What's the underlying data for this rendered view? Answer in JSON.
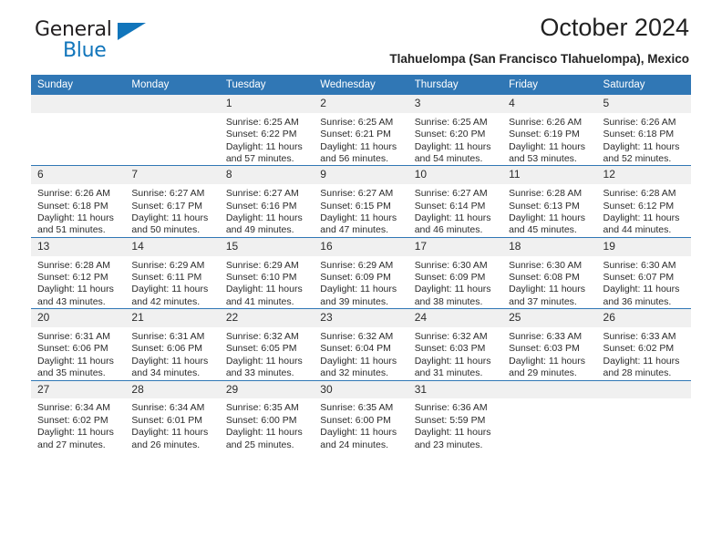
{
  "brand": {
    "name_part1": "General",
    "name_part2": "Blue",
    "accent_color": "#1175bb"
  },
  "header": {
    "title": "October 2024",
    "subtitle": "Tlahuelompa (San Francisco Tlahuelompa), Mexico",
    "header_bg": "#3077b5"
  },
  "weekdays": [
    "Sunday",
    "Monday",
    "Tuesday",
    "Wednesday",
    "Thursday",
    "Friday",
    "Saturday"
  ],
  "labels": {
    "sunrise_prefix": "Sunrise: ",
    "sunset_prefix": "Sunset: ",
    "daylight_prefix": "Daylight: "
  },
  "weeks": [
    [
      {
        "day": "",
        "sunrise": "",
        "sunset": "",
        "daylight_line1": "",
        "daylight_line2": ""
      },
      {
        "day": "",
        "sunrise": "",
        "sunset": "",
        "daylight_line1": "",
        "daylight_line2": ""
      },
      {
        "day": "1",
        "sunrise": "Sunrise: 6:25 AM",
        "sunset": "Sunset: 6:22 PM",
        "daylight_line1": "Daylight: 11 hours",
        "daylight_line2": "and 57 minutes."
      },
      {
        "day": "2",
        "sunrise": "Sunrise: 6:25 AM",
        "sunset": "Sunset: 6:21 PM",
        "daylight_line1": "Daylight: 11 hours",
        "daylight_line2": "and 56 minutes."
      },
      {
        "day": "3",
        "sunrise": "Sunrise: 6:25 AM",
        "sunset": "Sunset: 6:20 PM",
        "daylight_line1": "Daylight: 11 hours",
        "daylight_line2": "and 54 minutes."
      },
      {
        "day": "4",
        "sunrise": "Sunrise: 6:26 AM",
        "sunset": "Sunset: 6:19 PM",
        "daylight_line1": "Daylight: 11 hours",
        "daylight_line2": "and 53 minutes."
      },
      {
        "day": "5",
        "sunrise": "Sunrise: 6:26 AM",
        "sunset": "Sunset: 6:18 PM",
        "daylight_line1": "Daylight: 11 hours",
        "daylight_line2": "and 52 minutes."
      }
    ],
    [
      {
        "day": "6",
        "sunrise": "Sunrise: 6:26 AM",
        "sunset": "Sunset: 6:18 PM",
        "daylight_line1": "Daylight: 11 hours",
        "daylight_line2": "and 51 minutes."
      },
      {
        "day": "7",
        "sunrise": "Sunrise: 6:27 AM",
        "sunset": "Sunset: 6:17 PM",
        "daylight_line1": "Daylight: 11 hours",
        "daylight_line2": "and 50 minutes."
      },
      {
        "day": "8",
        "sunrise": "Sunrise: 6:27 AM",
        "sunset": "Sunset: 6:16 PM",
        "daylight_line1": "Daylight: 11 hours",
        "daylight_line2": "and 49 minutes."
      },
      {
        "day": "9",
        "sunrise": "Sunrise: 6:27 AM",
        "sunset": "Sunset: 6:15 PM",
        "daylight_line1": "Daylight: 11 hours",
        "daylight_line2": "and 47 minutes."
      },
      {
        "day": "10",
        "sunrise": "Sunrise: 6:27 AM",
        "sunset": "Sunset: 6:14 PM",
        "daylight_line1": "Daylight: 11 hours",
        "daylight_line2": "and 46 minutes."
      },
      {
        "day": "11",
        "sunrise": "Sunrise: 6:28 AM",
        "sunset": "Sunset: 6:13 PM",
        "daylight_line1": "Daylight: 11 hours",
        "daylight_line2": "and 45 minutes."
      },
      {
        "day": "12",
        "sunrise": "Sunrise: 6:28 AM",
        "sunset": "Sunset: 6:12 PM",
        "daylight_line1": "Daylight: 11 hours",
        "daylight_line2": "and 44 minutes."
      }
    ],
    [
      {
        "day": "13",
        "sunrise": "Sunrise: 6:28 AM",
        "sunset": "Sunset: 6:12 PM",
        "daylight_line1": "Daylight: 11 hours",
        "daylight_line2": "and 43 minutes."
      },
      {
        "day": "14",
        "sunrise": "Sunrise: 6:29 AM",
        "sunset": "Sunset: 6:11 PM",
        "daylight_line1": "Daylight: 11 hours",
        "daylight_line2": "and 42 minutes."
      },
      {
        "day": "15",
        "sunrise": "Sunrise: 6:29 AM",
        "sunset": "Sunset: 6:10 PM",
        "daylight_line1": "Daylight: 11 hours",
        "daylight_line2": "and 41 minutes."
      },
      {
        "day": "16",
        "sunrise": "Sunrise: 6:29 AM",
        "sunset": "Sunset: 6:09 PM",
        "daylight_line1": "Daylight: 11 hours",
        "daylight_line2": "and 39 minutes."
      },
      {
        "day": "17",
        "sunrise": "Sunrise: 6:30 AM",
        "sunset": "Sunset: 6:09 PM",
        "daylight_line1": "Daylight: 11 hours",
        "daylight_line2": "and 38 minutes."
      },
      {
        "day": "18",
        "sunrise": "Sunrise: 6:30 AM",
        "sunset": "Sunset: 6:08 PM",
        "daylight_line1": "Daylight: 11 hours",
        "daylight_line2": "and 37 minutes."
      },
      {
        "day": "19",
        "sunrise": "Sunrise: 6:30 AM",
        "sunset": "Sunset: 6:07 PM",
        "daylight_line1": "Daylight: 11 hours",
        "daylight_line2": "and 36 minutes."
      }
    ],
    [
      {
        "day": "20",
        "sunrise": "Sunrise: 6:31 AM",
        "sunset": "Sunset: 6:06 PM",
        "daylight_line1": "Daylight: 11 hours",
        "daylight_line2": "and 35 minutes."
      },
      {
        "day": "21",
        "sunrise": "Sunrise: 6:31 AM",
        "sunset": "Sunset: 6:06 PM",
        "daylight_line1": "Daylight: 11 hours",
        "daylight_line2": "and 34 minutes."
      },
      {
        "day": "22",
        "sunrise": "Sunrise: 6:32 AM",
        "sunset": "Sunset: 6:05 PM",
        "daylight_line1": "Daylight: 11 hours",
        "daylight_line2": "and 33 minutes."
      },
      {
        "day": "23",
        "sunrise": "Sunrise: 6:32 AM",
        "sunset": "Sunset: 6:04 PM",
        "daylight_line1": "Daylight: 11 hours",
        "daylight_line2": "and 32 minutes."
      },
      {
        "day": "24",
        "sunrise": "Sunrise: 6:32 AM",
        "sunset": "Sunset: 6:03 PM",
        "daylight_line1": "Daylight: 11 hours",
        "daylight_line2": "and 31 minutes."
      },
      {
        "day": "25",
        "sunrise": "Sunrise: 6:33 AM",
        "sunset": "Sunset: 6:03 PM",
        "daylight_line1": "Daylight: 11 hours",
        "daylight_line2": "and 29 minutes."
      },
      {
        "day": "26",
        "sunrise": "Sunrise: 6:33 AM",
        "sunset": "Sunset: 6:02 PM",
        "daylight_line1": "Daylight: 11 hours",
        "daylight_line2": "and 28 minutes."
      }
    ],
    [
      {
        "day": "27",
        "sunrise": "Sunrise: 6:34 AM",
        "sunset": "Sunset: 6:02 PM",
        "daylight_line1": "Daylight: 11 hours",
        "daylight_line2": "and 27 minutes."
      },
      {
        "day": "28",
        "sunrise": "Sunrise: 6:34 AM",
        "sunset": "Sunset: 6:01 PM",
        "daylight_line1": "Daylight: 11 hours",
        "daylight_line2": "and 26 minutes."
      },
      {
        "day": "29",
        "sunrise": "Sunrise: 6:35 AM",
        "sunset": "Sunset: 6:00 PM",
        "daylight_line1": "Daylight: 11 hours",
        "daylight_line2": "and 25 minutes."
      },
      {
        "day": "30",
        "sunrise": "Sunrise: 6:35 AM",
        "sunset": "Sunset: 6:00 PM",
        "daylight_line1": "Daylight: 11 hours",
        "daylight_line2": "and 24 minutes."
      },
      {
        "day": "31",
        "sunrise": "Sunrise: 6:36 AM",
        "sunset": "Sunset: 5:59 PM",
        "daylight_line1": "Daylight: 11 hours",
        "daylight_line2": "and 23 minutes."
      },
      {
        "day": "",
        "sunrise": "",
        "sunset": "",
        "daylight_line1": "",
        "daylight_line2": ""
      },
      {
        "day": "",
        "sunrise": "",
        "sunset": "",
        "daylight_line1": "",
        "daylight_line2": ""
      }
    ]
  ]
}
